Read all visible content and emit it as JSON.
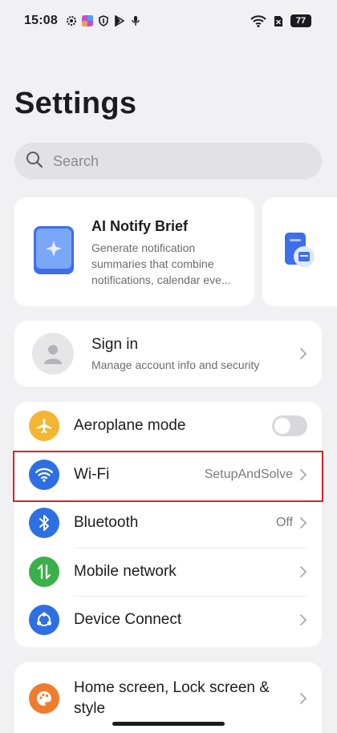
{
  "status_bar": {
    "time": "15:08",
    "battery": "77",
    "icons": [
      "gear-icon",
      "app-icon",
      "shield-icon",
      "play-icon",
      "mic-icon",
      "wifi-icon",
      "sim-icon",
      "battery-icon"
    ]
  },
  "page": {
    "title": "Settings"
  },
  "search": {
    "placeholder": "Search"
  },
  "promo": {
    "title": "AI Notify Brief",
    "description": "Generate notification summaries that combine notifications, calendar eve..."
  },
  "account": {
    "title": "Sign in",
    "subtitle": "Manage account info and security"
  },
  "connectivity": [
    {
      "label": "Aeroplane mode",
      "icon": "airplane-icon",
      "color": "#f3b532",
      "control": "toggle",
      "on": false
    },
    {
      "label": "Wi-Fi",
      "icon": "wifi-icon",
      "color": "#2f6fe4",
      "value": "SetupAndSolve"
    },
    {
      "label": "Bluetooth",
      "icon": "bluetooth-icon",
      "color": "#2f6fe4",
      "value": "Off"
    },
    {
      "label": "Mobile network",
      "icon": "mobile-network-icon",
      "color": "#3ab04a",
      "value": ""
    },
    {
      "label": "Device Connect",
      "icon": "device-connect-icon",
      "color": "#2f6fe4",
      "value": ""
    }
  ],
  "personalize": [
    {
      "label": "Home screen, Lock screen & style",
      "icon": "palette-icon",
      "color": "#ef7d2d"
    }
  ]
}
